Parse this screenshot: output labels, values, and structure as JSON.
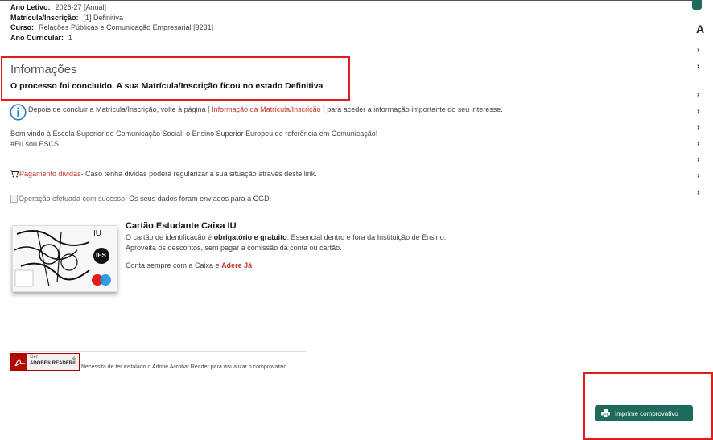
{
  "meta": {
    "ano_letivo_label": "Ano Letivo:",
    "ano_letivo_value": "2026-27 [Anual]",
    "matricula_label": "Matrícula/Inscrição:",
    "matricula_value": "[1] Definitiva",
    "curso_label": "Curso:",
    "curso_value": "Relações Públicas e Comunicação Empresarial [9231]",
    "ano_curricular_label": "Ano Curricular:",
    "ano_curricular_value": "1"
  },
  "top_right_letter": "A",
  "info": {
    "title": "Informações",
    "status": "O processo foi concluído. A sua Matrícula/Inscrição ficou no estado  Definitiva"
  },
  "after_line": {
    "before": "Depois de concluir a Matrícula/Inscrição, volte à página [ ",
    "link": "Informação da Matrícula/Inscrição",
    "after": " ] para aceder a informação importante do seu interesse."
  },
  "welcome": {
    "line1": "Bem vindo à Escola Superior de Comunicação Social, o Ensino Superior Europeu de referência em Comunicação!",
    "line2": "#Eu sou ESCS"
  },
  "payment": {
    "link": "Pagamento dividas",
    "text": "- Caso tenha dividas poderá regularizar a sua situação através deste link."
  },
  "cgd": {
    "alt": "Operação efetuada com sucesso!",
    "text": " Os seus dados foram enviados para a CGD."
  },
  "card": {
    "logo_text": "IU",
    "ies_text": "IES",
    "title": "Cartão Estudante Caixa IU",
    "line1_a": "O cartão de identificação é ",
    "line1_b": "obrigatório e gratuito",
    "line1_c": ". Essencial dentro e fora da Instituição de Ensino.",
    "line2": "Aproveita os descontos, sem pagar a comissão da conta ou cartão.",
    "cta_a": "Conta sempre com a Caixa e ",
    "cta_link": "Adere Já",
    "cta_b": "!"
  },
  "acrobat": {
    "get": "Get",
    "brand": "ADOBE® READER®",
    "note": "Necessita de ter instalado o Adobe Acrobat Reader para visualizar o comprovativo."
  },
  "print_button": {
    "label": "Imprime comprovativo"
  },
  "colors": {
    "accent": "#1e6b5c",
    "highlight": "#e21b1b",
    "link": "#c0392b"
  },
  "side_arrow_glyph": "›"
}
